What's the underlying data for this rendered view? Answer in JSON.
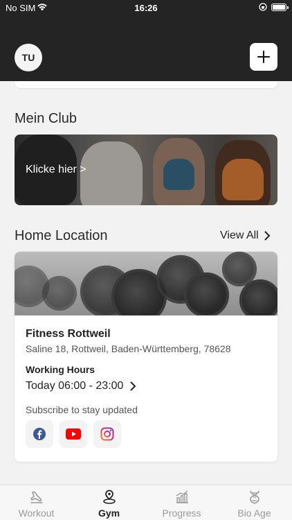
{
  "status_bar": {
    "carrier": "No SIM",
    "time": "16:26"
  },
  "header": {
    "avatar_initials": "TU"
  },
  "club": {
    "section_title": "Mein Club",
    "card_label": "Klicke hier >"
  },
  "home_location": {
    "section_title": "Home Location",
    "view_all_label": "View All",
    "gym_name": "Fitness Rottweil",
    "address": "Saline 18, Rottweil, Baden-Württemberg, 78628",
    "working_hours_label": "Working Hours",
    "working_hours_value": "Today 06:00 - 23:00",
    "subscribe_label": "Subscribe to stay updated",
    "social": [
      {
        "icon": "facebook-icon",
        "color": "#3b5998"
      },
      {
        "icon": "youtube-icon",
        "color": "#ff0000"
      },
      {
        "icon": "instagram-icon",
        "color": "#c13584"
      }
    ]
  },
  "tabs": [
    {
      "label": "Workout",
      "icon": "workout-icon",
      "active": false
    },
    {
      "label": "Gym",
      "icon": "gym-location-icon",
      "active": true
    },
    {
      "label": "Progress",
      "icon": "progress-chart-icon",
      "active": false
    },
    {
      "label": "Bio Age",
      "icon": "bio-age-icon",
      "active": false
    }
  ]
}
